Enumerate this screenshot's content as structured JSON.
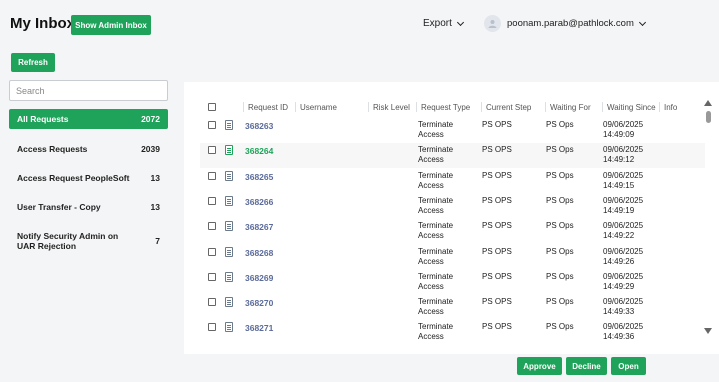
{
  "header": {
    "title": "My Inbox",
    "admin_button": "Show Admin Inbox",
    "export_label": "Export",
    "user_email": "poonam.parab@pathlock.com"
  },
  "toolbar": {
    "refresh_label": "Refresh"
  },
  "sidebar": {
    "search_placeholder": "Search",
    "items": [
      {
        "label": "All Requests",
        "count": "2072"
      },
      {
        "label": "Access Requests",
        "count": "2039"
      },
      {
        "label": "Access Request PeopleSoft",
        "count": "13"
      },
      {
        "label": "User Transfer - Copy",
        "count": "13"
      },
      {
        "label": "Notify Security Admin on UAR Rejection",
        "count": "7"
      }
    ]
  },
  "table": {
    "columns": [
      "Request ID",
      "Username",
      "Risk Level",
      "Request Type",
      "Current Step",
      "Waiting For",
      "Waiting Since",
      "Info"
    ],
    "rows": [
      {
        "id": "368263",
        "username": "",
        "risk": "",
        "type": "Terminate Access",
        "step": "PS OPS",
        "waiting_for": "PS Ops",
        "since_date": "09/06/2025",
        "since_time": "14:49:09"
      },
      {
        "id": "368264",
        "username": "",
        "risk": "",
        "type": "Terminate Access",
        "step": "PS OPS",
        "waiting_for": "PS Ops",
        "since_date": "09/06/2025",
        "since_time": "14:49:12"
      },
      {
        "id": "368265",
        "username": "",
        "risk": "",
        "type": "Terminate Access",
        "step": "PS OPS",
        "waiting_for": "PS Ops",
        "since_date": "09/06/2025",
        "since_time": "14:49:15"
      },
      {
        "id": "368266",
        "username": "",
        "risk": "",
        "type": "Terminate Access",
        "step": "PS OPS",
        "waiting_for": "PS Ops",
        "since_date": "09/06/2025",
        "since_time": "14:49:19"
      },
      {
        "id": "368267",
        "username": "",
        "risk": "",
        "type": "Terminate Access",
        "step": "PS OPS",
        "waiting_for": "PS Ops",
        "since_date": "09/06/2025",
        "since_time": "14:49:22"
      },
      {
        "id": "368268",
        "username": "",
        "risk": "",
        "type": "Terminate Access",
        "step": "PS OPS",
        "waiting_for": "PS Ops",
        "since_date": "09/06/2025",
        "since_time": "14:49:26"
      },
      {
        "id": "368269",
        "username": "",
        "risk": "",
        "type": "Terminate Access",
        "step": "PS OPS",
        "waiting_for": "PS Ops",
        "since_date": "09/06/2025",
        "since_time": "14:49:29"
      },
      {
        "id": "368270",
        "username": "",
        "risk": "",
        "type": "Terminate Access",
        "step": "PS OPS",
        "waiting_for": "PS Ops",
        "since_date": "09/06/2025",
        "since_time": "14:49:33"
      },
      {
        "id": "368271",
        "username": "",
        "risk": "",
        "type": "Terminate Access",
        "step": "PS OPS",
        "waiting_for": "PS Ops",
        "since_date": "09/06/2025",
        "since_time": "14:49:36"
      }
    ]
  },
  "actions": {
    "approve": "Approve",
    "decline": "Decline",
    "open": "Open"
  },
  "colors": {
    "accent": "#1fa35a",
    "link": "#5b6b9a"
  }
}
